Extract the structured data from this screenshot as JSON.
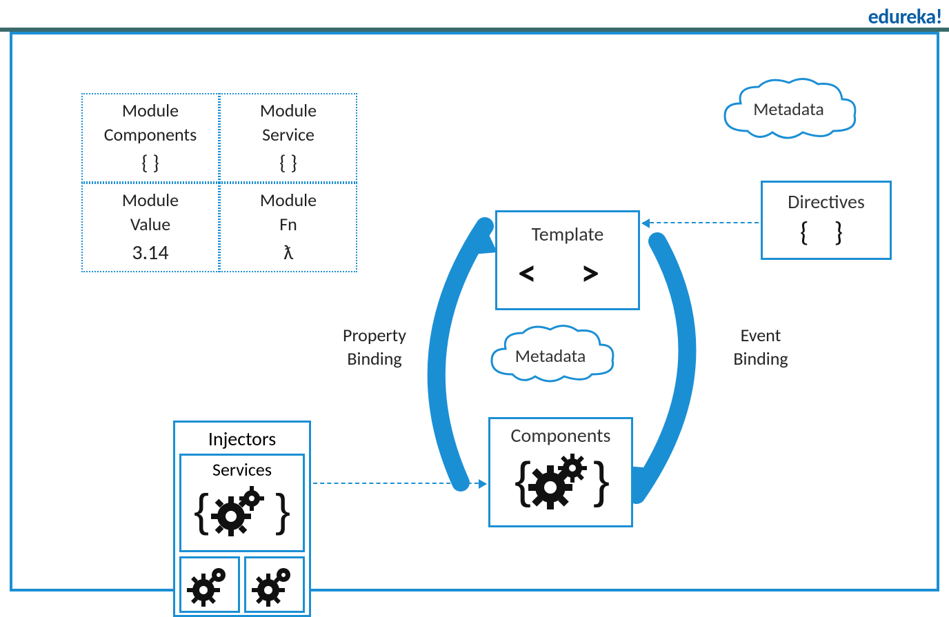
{
  "brand": "edureka!",
  "modules": {
    "components": {
      "line1": "Module",
      "line2": "Components",
      "symbol": "{ }"
    },
    "service": {
      "line1": "Module",
      "line2": "Service",
      "symbol": "{ }"
    },
    "value": {
      "line1": "Module",
      "line2": "Value",
      "symbol": "3.14"
    },
    "fn": {
      "line1": "Module",
      "line2": "Fn",
      "symbol": "ƛ"
    }
  },
  "template": {
    "label": "Template",
    "symbol": "< >"
  },
  "components": {
    "label": "Components"
  },
  "directives": {
    "label": "Directives",
    "symbol": "{ }"
  },
  "metadata_top": "Metadata",
  "metadata_center": "Metadata",
  "property_binding": "Property\nBinding",
  "event_binding": "Event\nBinding",
  "injectors": {
    "title": "Injectors",
    "services": "Services"
  }
}
